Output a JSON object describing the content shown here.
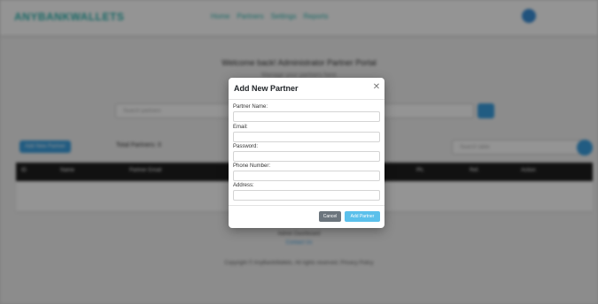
{
  "background": {
    "logo": "ANYBANKWALLETS",
    "nav_items": [
      "Home",
      "Partners",
      "Settings",
      "Reports"
    ],
    "welcome": "Welcome back! Administrator Partner Portal",
    "welcome_sub": "Manage your partners here",
    "search_placeholder": "Search partners",
    "add_partner_button": "Add New Partner",
    "total_partners": "Total Partners: 0",
    "filter_placeholder": "Search table",
    "table_headers": [
      "ID",
      "Name",
      "Partner Email",
      "",
      "",
      "Ph.",
      "Ref.",
      "Action"
    ],
    "footer_line1": "Admin Dashboard",
    "footer_line2": "Contact Us",
    "footer_line3": "Copyright © AnyBankWallets. All rights reserved. Privacy Policy"
  },
  "modal": {
    "title": "Add New Partner",
    "close_symbol": "✕",
    "fields": [
      {
        "label": "Partner Name:",
        "value": "",
        "placeholder": ""
      },
      {
        "label": "Email:",
        "value": "",
        "placeholder": ""
      },
      {
        "label": "Password:",
        "value": "",
        "placeholder": ""
      },
      {
        "label": "Phone Number:",
        "value": "",
        "placeholder": ""
      },
      {
        "label": "Address:",
        "value": "",
        "placeholder": ""
      }
    ],
    "cancel_label": "Cancel",
    "submit_label": "Add Partner"
  },
  "colors": {
    "accent": "#3a9fe0",
    "brand": "#2bb5b0",
    "cancel": "#6c757d",
    "submit": "#5bc0eb"
  }
}
